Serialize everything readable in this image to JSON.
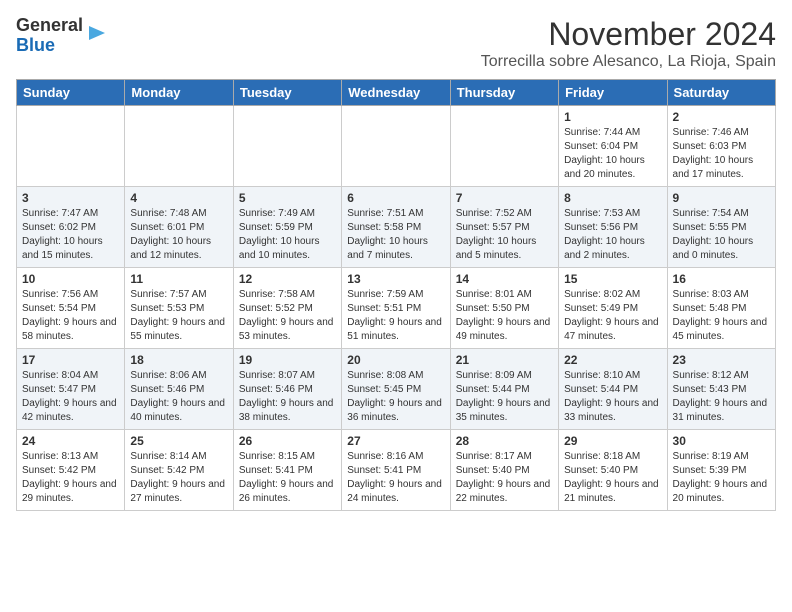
{
  "logo": {
    "line1": "General",
    "line2": "Blue"
  },
  "header": {
    "month": "November 2024",
    "location": "Torrecilla sobre Alesanco, La Rioja, Spain"
  },
  "weekdays": [
    "Sunday",
    "Monday",
    "Tuesday",
    "Wednesday",
    "Thursday",
    "Friday",
    "Saturday"
  ],
  "weeks": [
    [
      {
        "day": "",
        "info": ""
      },
      {
        "day": "",
        "info": ""
      },
      {
        "day": "",
        "info": ""
      },
      {
        "day": "",
        "info": ""
      },
      {
        "day": "",
        "info": ""
      },
      {
        "day": "1",
        "info": "Sunrise: 7:44 AM\nSunset: 6:04 PM\nDaylight: 10 hours and 20 minutes."
      },
      {
        "day": "2",
        "info": "Sunrise: 7:46 AM\nSunset: 6:03 PM\nDaylight: 10 hours and 17 minutes."
      }
    ],
    [
      {
        "day": "3",
        "info": "Sunrise: 7:47 AM\nSunset: 6:02 PM\nDaylight: 10 hours and 15 minutes."
      },
      {
        "day": "4",
        "info": "Sunrise: 7:48 AM\nSunset: 6:01 PM\nDaylight: 10 hours and 12 minutes."
      },
      {
        "day": "5",
        "info": "Sunrise: 7:49 AM\nSunset: 5:59 PM\nDaylight: 10 hours and 10 minutes."
      },
      {
        "day": "6",
        "info": "Sunrise: 7:51 AM\nSunset: 5:58 PM\nDaylight: 10 hours and 7 minutes."
      },
      {
        "day": "7",
        "info": "Sunrise: 7:52 AM\nSunset: 5:57 PM\nDaylight: 10 hours and 5 minutes."
      },
      {
        "day": "8",
        "info": "Sunrise: 7:53 AM\nSunset: 5:56 PM\nDaylight: 10 hours and 2 minutes."
      },
      {
        "day": "9",
        "info": "Sunrise: 7:54 AM\nSunset: 5:55 PM\nDaylight: 10 hours and 0 minutes."
      }
    ],
    [
      {
        "day": "10",
        "info": "Sunrise: 7:56 AM\nSunset: 5:54 PM\nDaylight: 9 hours and 58 minutes."
      },
      {
        "day": "11",
        "info": "Sunrise: 7:57 AM\nSunset: 5:53 PM\nDaylight: 9 hours and 55 minutes."
      },
      {
        "day": "12",
        "info": "Sunrise: 7:58 AM\nSunset: 5:52 PM\nDaylight: 9 hours and 53 minutes."
      },
      {
        "day": "13",
        "info": "Sunrise: 7:59 AM\nSunset: 5:51 PM\nDaylight: 9 hours and 51 minutes."
      },
      {
        "day": "14",
        "info": "Sunrise: 8:01 AM\nSunset: 5:50 PM\nDaylight: 9 hours and 49 minutes."
      },
      {
        "day": "15",
        "info": "Sunrise: 8:02 AM\nSunset: 5:49 PM\nDaylight: 9 hours and 47 minutes."
      },
      {
        "day": "16",
        "info": "Sunrise: 8:03 AM\nSunset: 5:48 PM\nDaylight: 9 hours and 45 minutes."
      }
    ],
    [
      {
        "day": "17",
        "info": "Sunrise: 8:04 AM\nSunset: 5:47 PM\nDaylight: 9 hours and 42 minutes."
      },
      {
        "day": "18",
        "info": "Sunrise: 8:06 AM\nSunset: 5:46 PM\nDaylight: 9 hours and 40 minutes."
      },
      {
        "day": "19",
        "info": "Sunrise: 8:07 AM\nSunset: 5:46 PM\nDaylight: 9 hours and 38 minutes."
      },
      {
        "day": "20",
        "info": "Sunrise: 8:08 AM\nSunset: 5:45 PM\nDaylight: 9 hours and 36 minutes."
      },
      {
        "day": "21",
        "info": "Sunrise: 8:09 AM\nSunset: 5:44 PM\nDaylight: 9 hours and 35 minutes."
      },
      {
        "day": "22",
        "info": "Sunrise: 8:10 AM\nSunset: 5:44 PM\nDaylight: 9 hours and 33 minutes."
      },
      {
        "day": "23",
        "info": "Sunrise: 8:12 AM\nSunset: 5:43 PM\nDaylight: 9 hours and 31 minutes."
      }
    ],
    [
      {
        "day": "24",
        "info": "Sunrise: 8:13 AM\nSunset: 5:42 PM\nDaylight: 9 hours and 29 minutes."
      },
      {
        "day": "25",
        "info": "Sunrise: 8:14 AM\nSunset: 5:42 PM\nDaylight: 9 hours and 27 minutes."
      },
      {
        "day": "26",
        "info": "Sunrise: 8:15 AM\nSunset: 5:41 PM\nDaylight: 9 hours and 26 minutes."
      },
      {
        "day": "27",
        "info": "Sunrise: 8:16 AM\nSunset: 5:41 PM\nDaylight: 9 hours and 24 minutes."
      },
      {
        "day": "28",
        "info": "Sunrise: 8:17 AM\nSunset: 5:40 PM\nDaylight: 9 hours and 22 minutes."
      },
      {
        "day": "29",
        "info": "Sunrise: 8:18 AM\nSunset: 5:40 PM\nDaylight: 9 hours and 21 minutes."
      },
      {
        "day": "30",
        "info": "Sunrise: 8:19 AM\nSunset: 5:39 PM\nDaylight: 9 hours and 20 minutes."
      }
    ]
  ]
}
